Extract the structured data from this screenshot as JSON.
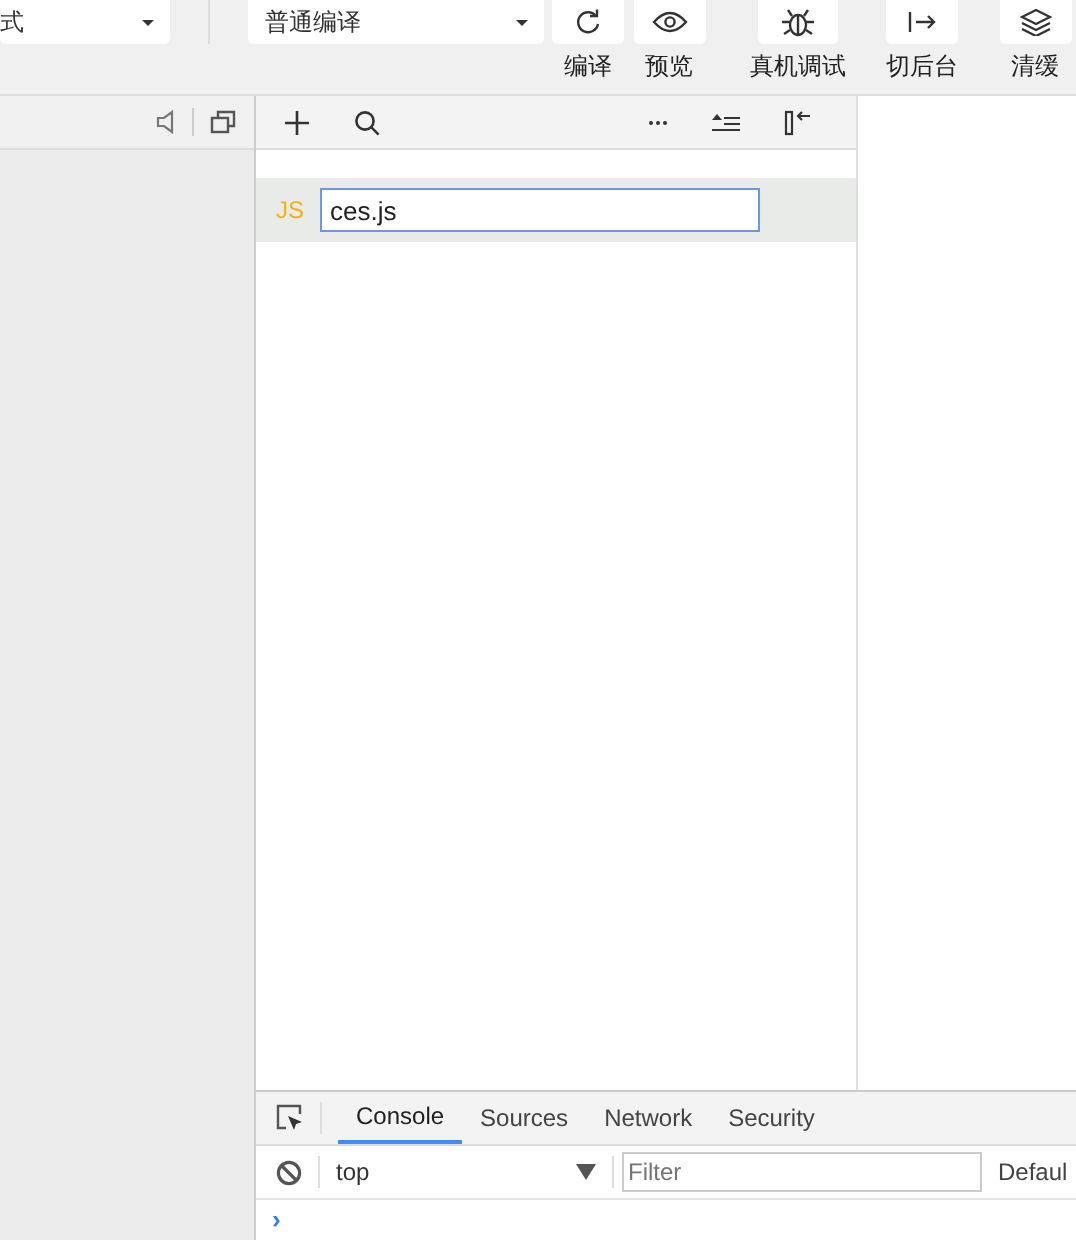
{
  "toolbar": {
    "mode_select": {
      "value": "式"
    },
    "compile_select": {
      "value": "普通编译"
    },
    "buttons": [
      {
        "kind": "refresh",
        "label": "编译"
      },
      {
        "kind": "eye",
        "label": "预览"
      },
      {
        "kind": "bug",
        "label": "真机调试"
      },
      {
        "kind": "exit",
        "label": "切后台"
      },
      {
        "kind": "layers",
        "label": "清缓"
      }
    ]
  },
  "file_tree": {
    "files": [
      {
        "badge": "JS",
        "name": "ces.js",
        "editing": true
      }
    ]
  },
  "devtools": {
    "tabs": [
      {
        "label": "Console",
        "selected": true
      },
      {
        "label": "Sources",
        "selected": false
      },
      {
        "label": "Network",
        "selected": false
      },
      {
        "label": "Security",
        "selected": false
      }
    ],
    "context": "top",
    "filter": {
      "placeholder": "Filter"
    },
    "levels": "Defaul",
    "prompt": "›"
  }
}
